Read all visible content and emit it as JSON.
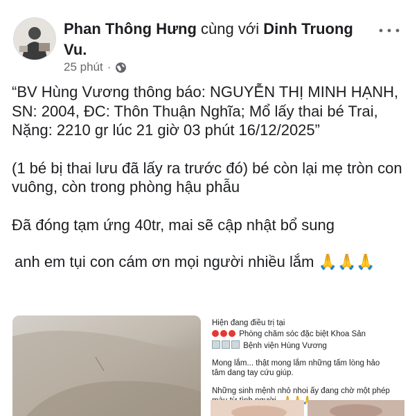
{
  "post": {
    "author": "Phan Thông Hưng",
    "with_text": "cùng với",
    "tagged": "Dinh Truong Vu.",
    "time": "25 phút",
    "dot": "·",
    "paragraphs": [
      "“BV Hùng Vương thông báo: NGUYỄN THỊ MINH HẠNH, SN: 2004, ĐC: Thôn Thuận Nghĩa; Mổ lấy thai bé Trai, Nặng: 2210 gr  lúc 21 giờ 03 phút 16/12/2025”",
      "(1 bé bị thai lưu đã lấy ra trước đó) bé còn lại mẹ tròn con vuông, còn trong phòng hậu phẫu",
      "Đã đóng tạm ứng 40tr, mai sẽ cập nhật bổ sung",
      "anh em tụi con cám ơn mọi người nhiều lắm 🙏🙏🙏"
    ]
  },
  "attachment": {
    "lines": [
      "Hiện đang điều trị tại",
      "Phòng chăm sóc đặc biệt Khoa Sản",
      "Bệnh viện Hùng Vương",
      "Mong lắm... thật mong lắm những tấm lòng hảo",
      "tâm dang tay cứu giúp.",
      "Những sinh mệnh nhỏ nhoi ấy đang chờ một phép",
      "màu từ tình người...🙏🙏🙏"
    ]
  },
  "icons": {
    "globe": "globe-icon",
    "more": "more-horizontal-icon"
  }
}
